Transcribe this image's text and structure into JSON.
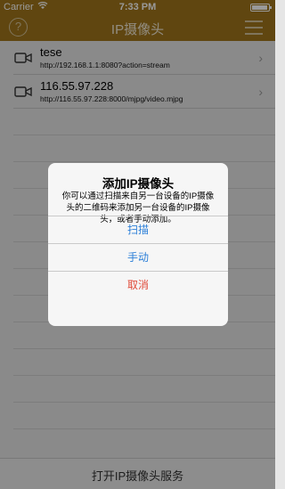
{
  "status_bar": {
    "carrier": "Carrier",
    "wifi_icon": "wifi-icon",
    "time": "7:33 PM",
    "battery_icon": "battery-icon"
  },
  "nav": {
    "title": "IP摄像头",
    "help_icon": "question-circle-icon",
    "help_symbol": "?",
    "menu_icon": "hamburger-menu-icon"
  },
  "cameras": [
    {
      "name": "tese",
      "url": "http://192.168.1.1:8080?action=stream"
    },
    {
      "name": "116.55.97.228",
      "url": "http://116.55.97.228:8000/mjpg/video.mjpg"
    }
  ],
  "dialog": {
    "title": "添加IP摄像头",
    "message": "你可以通过扫描来自另一台设备的IP摄像头的二维码来添加另一台设备的IP摄像头，或者手动添加。",
    "buttons": {
      "scan": "扫描",
      "manual": "手动",
      "cancel": "取消"
    },
    "colors": {
      "action": "#2b7fd8",
      "cancel": "#e04b3a"
    }
  },
  "bottom_bar": {
    "label": "打开IP摄像头服务"
  },
  "colors": {
    "brand": "#a0761c"
  }
}
